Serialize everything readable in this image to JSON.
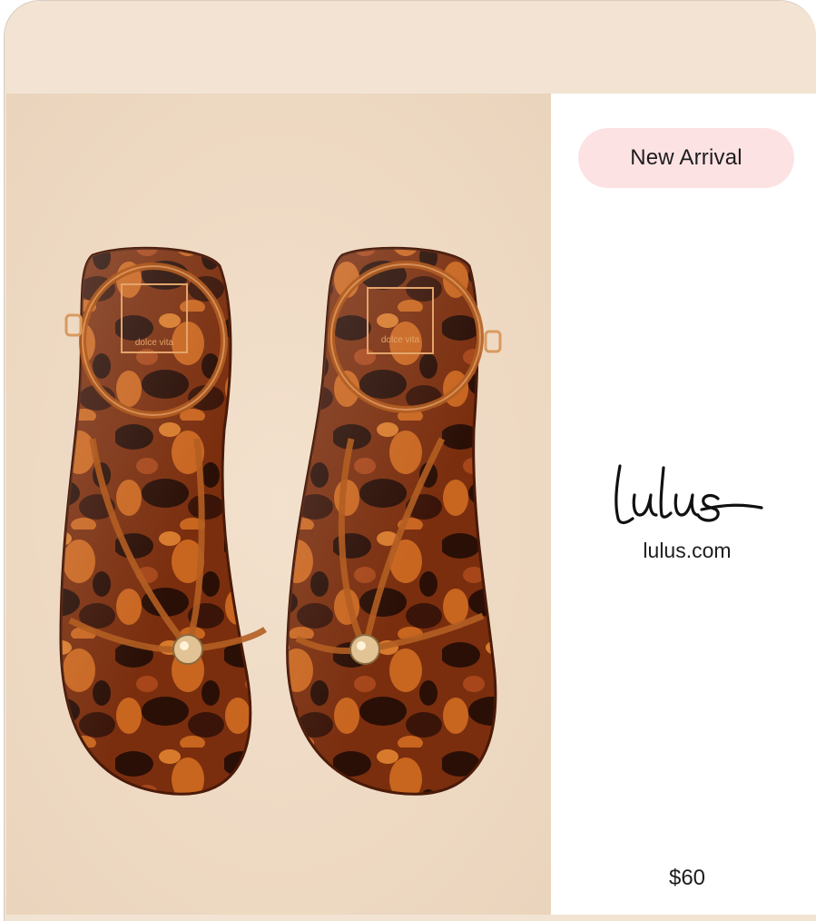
{
  "product": {
    "image_alt": "Tortoise shell strappy thong sandals",
    "insole_brand_text": "dolce vita",
    "badge": "New Arrival",
    "price": "$60"
  },
  "store": {
    "logo_text": "Lulus",
    "url": "lulus.com"
  },
  "colors": {
    "card_background": "#f3e3d2",
    "badge_background": "#fde2e4",
    "text": "#1d1d1d",
    "tortoise_dark": "#2a0f06",
    "tortoise_mid": "#7a2e0e",
    "tortoise_light": "#c8651f"
  }
}
